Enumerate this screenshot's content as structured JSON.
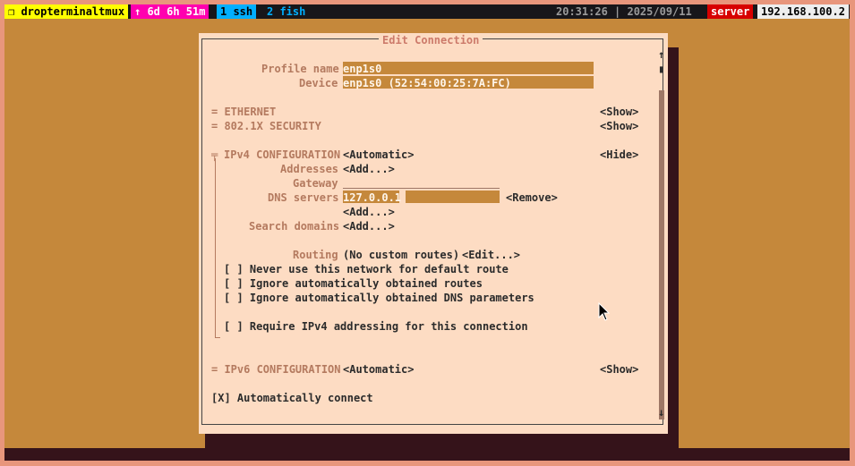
{
  "tmux": {
    "session": "❐ dropterminaltmux",
    "uptime": "↑ 6d 6h 51m",
    "window1": "1 ssh",
    "window2": "2 fish",
    "datetime": "20:31:26 | 2025/09/11",
    "host": "server",
    "ip": "192.168.100.2",
    "colors": {
      "session_bg": "#ffff00",
      "uptime_bg": "#ff00af",
      "active_bg": "#00afff",
      "host_bg": "#d70000",
      "ip_bg": "#eeeeee"
    }
  },
  "dialog": {
    "title": "Edit Connection",
    "profile_name_label": "Profile name",
    "profile_name_value": "enp1s0",
    "device_label": "Device",
    "device_value": "enp1s0 (52:54:00:25:7A:FC)",
    "ethernet": "= ETHERNET",
    "ethernet_toggle": "<Show>",
    "security": "= 802.1X SECURITY",
    "security_toggle": "<Show>",
    "ipv4_marker": "╤",
    "ipv4_title": "IPv4 CONFIGURATION",
    "ipv4_mode": "<Automatic>",
    "ipv4_toggle": "<Hide>",
    "addresses_label": "Addresses",
    "addresses_add": "<Add...>",
    "gateway_label": "Gateway",
    "dns_label": "DNS servers",
    "dns_value": "127.0.0.1",
    "dns_remove": "<Remove>",
    "dns_add": "<Add...>",
    "search_label": "Search domains",
    "search_add": "<Add...>",
    "routing_label": "Routing",
    "routing_value": "(No custom routes)",
    "routing_edit": "<Edit...>",
    "cb_default_route": "[ ] Never use this network for default route",
    "cb_ignore_routes": "[ ] Ignore automatically obtained routes",
    "cb_ignore_dns": "[ ] Ignore automatically obtained DNS parameters",
    "cb_require_ipv4": "[ ] Require IPv4 addressing for this connection",
    "ipv6_title": "= IPv6 CONFIGURATION",
    "ipv6_mode": "<Automatic>",
    "ipv6_toggle": "<Show>",
    "autoconnect": "[X] Automatically connect",
    "scroll_up": "↑",
    "scroll_thumb": "▮",
    "scroll_down": "↓"
  }
}
